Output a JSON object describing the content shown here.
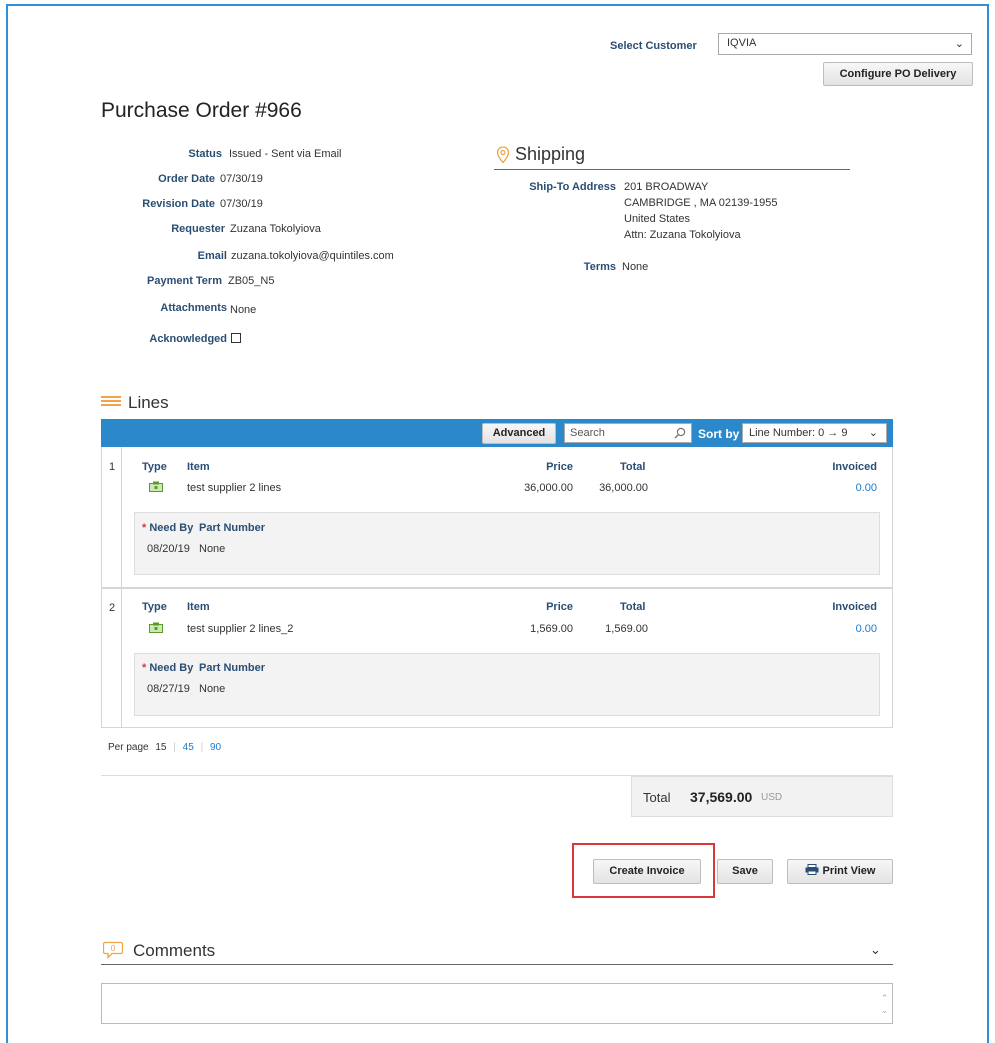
{
  "header": {
    "select_customer_label": "Select Customer",
    "customer_value": "IQVIA",
    "configure_btn": "Configure PO Delivery"
  },
  "po": {
    "title": "Purchase Order #966"
  },
  "details": [
    {
      "label": "Status",
      "value": "Issued - Sent via Email"
    },
    {
      "label": "Order Date",
      "value": "07/30/19"
    },
    {
      "label": "Revision Date",
      "value": "07/30/19"
    },
    {
      "label": "Requester",
      "value": "Zuzana Tokolyiova"
    },
    {
      "label": "Email",
      "value": "zuzana.tokolyiova@quintiles.com"
    },
    {
      "label": "Payment Term",
      "value": "ZB05_N5"
    },
    {
      "label": "Attachments",
      "value": "None"
    },
    {
      "label": "Acknowledged",
      "value": ""
    }
  ],
  "shipping": {
    "title": "Shipping",
    "ship_to_label": "Ship-To Address",
    "address": [
      "201 BROADWAY",
      "CAMBRIDGE , MA 02139-1955",
      "United States",
      "Attn: Zuzana Tokolyiova"
    ],
    "terms_label": "Terms",
    "terms_value": "None"
  },
  "lines": {
    "title": "Lines",
    "advanced_btn": "Advanced",
    "search_placeholder": "Search",
    "sort_label": "Sort by",
    "sort_value": "Line Number: 0 → 9",
    "headers": {
      "type": "Type",
      "item": "Item",
      "price": "Price",
      "total": "Total",
      "invoiced": "Invoiced",
      "need_by": "Need By",
      "part_number": "Part Number"
    },
    "items": [
      {
        "num": "1",
        "item": "test supplier 2 lines",
        "price": "36,000.00",
        "total": "36,000.00",
        "invoiced": "0.00",
        "need_by": "08/20/19",
        "part_number": "None"
      },
      {
        "num": "2",
        "item": "test supplier 2 lines_2",
        "price": "1,569.00",
        "total": "1,569.00",
        "invoiced": "0.00",
        "need_by": "08/27/19",
        "part_number": "None"
      }
    ],
    "per_page_label": "Per page",
    "per_page_options": [
      "15",
      "45",
      "90"
    ]
  },
  "summary": {
    "total_label": "Total",
    "total_value": "37,569.00",
    "currency": "USD"
  },
  "actions": {
    "create_invoice": "Create Invoice",
    "save": "Save",
    "print_view": "Print View"
  },
  "comments": {
    "title": "Comments",
    "count": "0"
  },
  "colors": {
    "accent_bar": "#2b88cb",
    "highlight": "#d9373c",
    "label_blue": "#2a4e73",
    "link": "#1a7ac8",
    "icon_orange": "#f0a34a"
  }
}
